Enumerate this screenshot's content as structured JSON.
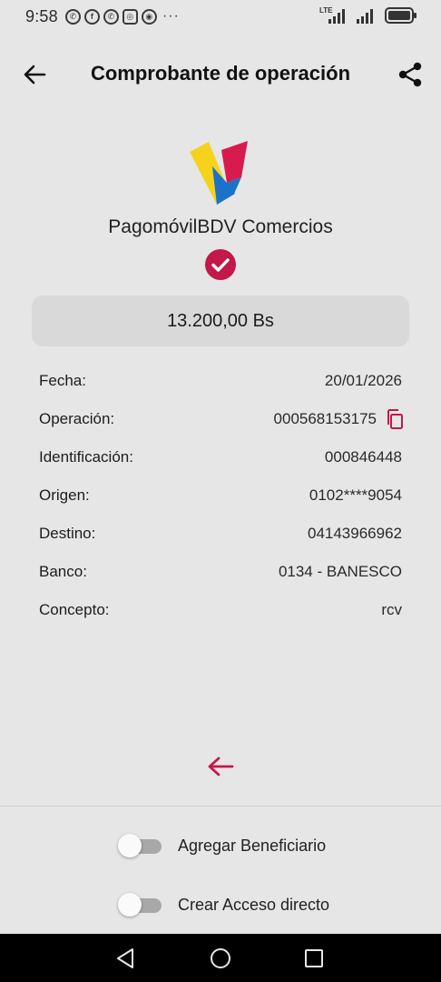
{
  "status_bar": {
    "time": "9:58",
    "left_icons": [
      "whatsapp-icon",
      "facebook-icon",
      "whatsapp-icon",
      "instagram-icon",
      "chrome-icon"
    ],
    "more": "···",
    "network_label": "LTE"
  },
  "header": {
    "title": "Comprobante de operación",
    "back_icon": "arrow-left-icon",
    "share_icon": "share-icon"
  },
  "brand": {
    "name": "PagomóvilBDV Comercios",
    "colors": {
      "yellow": "#f5d31d",
      "blue": "#1a73c9",
      "red": "#d81b4e"
    }
  },
  "amount": "13.200,00 Bs",
  "details": [
    {
      "label": "Fecha:",
      "value": "20/01/2026"
    },
    {
      "label": "Operación:",
      "value": "000568153175"
    },
    {
      "label": "Identificación:",
      "value": "000846448"
    },
    {
      "label": "Origen:",
      "value": "0102****9054"
    },
    {
      "label": "Destino:",
      "value": "04143966962"
    },
    {
      "label": "Banco:",
      "value": "0134 - BANESCO"
    },
    {
      "label": "Concepto:",
      "value": "rcv"
    }
  ],
  "toggles": [
    {
      "label": "Agregar Beneficiario",
      "on": false
    },
    {
      "label": "Crear Acceso directo",
      "on": false
    }
  ],
  "colors": {
    "accent": "#c2184a",
    "background": "#e6e6e6",
    "amount_box": "#d9d9d9"
  }
}
